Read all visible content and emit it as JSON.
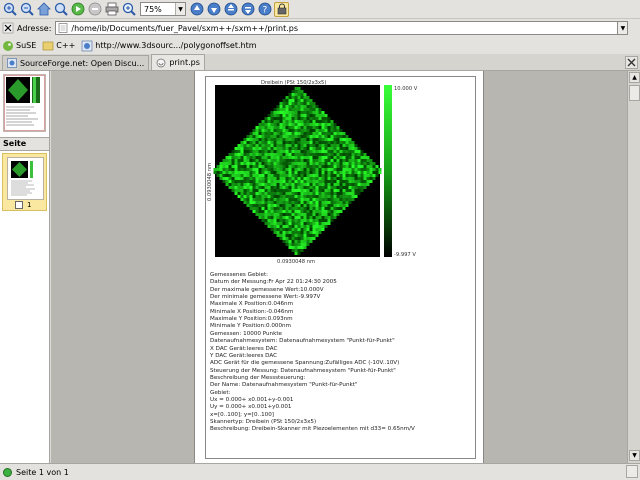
{
  "toolbar": {
    "buttons": [
      {
        "icon": "zoom-in-icon",
        "name": "zoom-in-button"
      },
      {
        "icon": "zoom-out-icon",
        "name": "zoom-out-button"
      },
      {
        "icon": "home-icon",
        "name": "home-button"
      },
      {
        "icon": "zoom-icon",
        "name": "zoom-button"
      },
      {
        "icon": "forward-icon",
        "name": "forward-button"
      },
      {
        "icon": "stop-icon",
        "name": "stop-button"
      },
      {
        "icon": "print-icon",
        "name": "print-button"
      },
      {
        "icon": "magnify-icon",
        "name": "magnify-button"
      }
    ],
    "zoom_value": "75%",
    "buttons_after": [
      {
        "icon": "previous-page-icon",
        "name": "previous-page-button"
      },
      {
        "icon": "next-page-icon",
        "name": "next-page-button"
      },
      {
        "icon": "first-page-icon",
        "name": "first-page-button"
      },
      {
        "icon": "last-page-icon",
        "name": "last-page-button"
      },
      {
        "icon": "help-icon",
        "name": "help-button"
      },
      {
        "icon": "lock-icon",
        "name": "lock-button"
      }
    ]
  },
  "address": {
    "label": "Adresse:",
    "value": "/home/ib/Documents/fuer_Pavel/sxm++/sxm++/print.ps"
  },
  "bookmarks": [
    {
      "label": "SuSE",
      "icon": "suse-icon"
    },
    {
      "label": "C++",
      "icon": "cpp-icon"
    },
    {
      "label": "http://www.3dsourc.../polygonoffset.htm",
      "icon": "web-page-icon"
    }
  ],
  "tabs": [
    {
      "label": "SourceForge.net: Open Discu...",
      "icon": "web-page-icon",
      "active": false
    },
    {
      "label": "print.ps",
      "icon": "document-icon",
      "active": true
    }
  ],
  "sidebar": {
    "header": "Seite",
    "page_number": "1"
  },
  "document": {
    "plot_title": "Dreibein (PSt 150/2x3x5)",
    "x_label": "0.0930048 nm",
    "y_label": "0.0930048 nm",
    "colorbar_max": "10.000 V",
    "colorbar_min": "-9.997 V",
    "info_lines": [
      "Gemessenes Gebiet:",
      "Datum der Messung:Fr Apr 22 01:24:30 2005",
      "Der maximale gemessene Wert:10.000V",
      "Der minimale gemessene Wert:-9.997V",
      "Maximale X Position:0.046nm",
      "Minimale X Position:-0.046nm",
      "Maximale Y Position:0.093nm",
      "Minimale Y Position:0.000nm",
      "Gemessen: 10000  Punkte",
      "Datenaufnahmesystem: Datenaufnahmesystem \"Punkt-für-Punkt\"",
      "X DAC Gerät:leeres DAC",
      "Y DAC Gerät:leeres DAC",
      "ADC Gerät für die gemessene Spannung:Zufälliges ADC (-10V..10V)",
      "Steuerung der Messung: Datenaufnahmesystem \"Punkt-für-Punkt\"",
      "Beschreibung der Messsteuerung:",
      "Der Name: Datenaufnahmesystem \"Punkt-für-Punkt\"",
      "Gebiet:",
      "Ux = 0.000+ x0.001+y-0.001",
      "Uy = 0.000+ x0.001+y0.001",
      "x=[0..100]; y=[0..100]",
      "Skannertyp: Dreibein (PSt 150/2x3x5)",
      "Beschreibung: Dreibein-Skanner mit Piezoelementen mit d33= 0.65nm/V"
    ]
  },
  "status": {
    "text": "Seite 1 von 1"
  },
  "colors": {
    "plot_background": "#000000",
    "plot_green": "#22c022",
    "selected_thumb": "#fbe8a0"
  }
}
